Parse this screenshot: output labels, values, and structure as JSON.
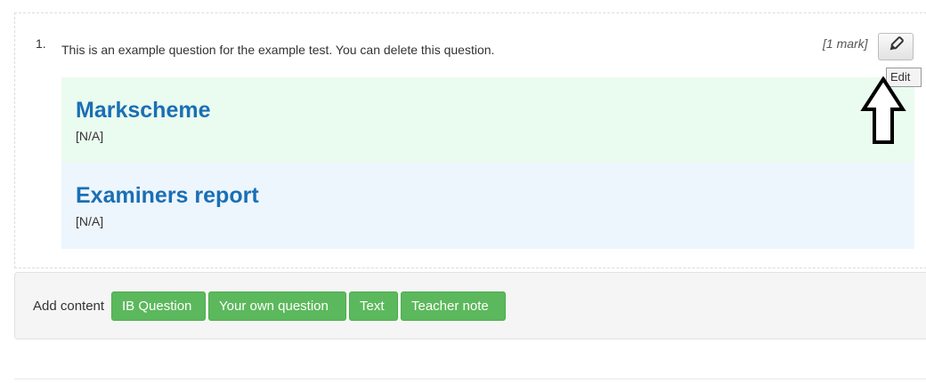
{
  "question": {
    "number": "1.",
    "text": "This is an example question for the example test. You can delete this question.",
    "marks": "[1 mark]",
    "edit_icon": "pencil-icon",
    "edit_tooltip": "Edit"
  },
  "markscheme": {
    "heading": "Markscheme",
    "value": "[N/A]"
  },
  "examiners_report": {
    "heading": "Examiners report",
    "value": "[N/A]"
  },
  "add_content": {
    "label": "Add content",
    "buttons": [
      "IB Question",
      "Your own question",
      "Text",
      "Teacher note"
    ]
  },
  "annotation": {
    "icon": "up-arrow-annotation"
  },
  "colors": {
    "heading_blue": "#1a6fb5",
    "markscheme_bg": "#eafbef",
    "examiners_bg": "#eef6fd",
    "button_green": "#5cb85c"
  }
}
